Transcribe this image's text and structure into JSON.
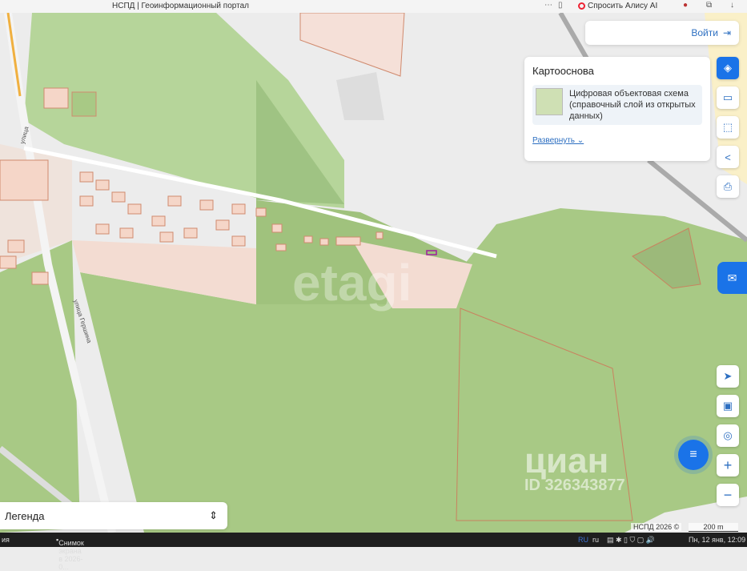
{
  "browser": {
    "tab_title": "НСПД | Геоинформационный портал",
    "alice_button": "Спросить Алису AI"
  },
  "header": {
    "login_label": "Войти",
    "login_icon": "login-arrow-icon"
  },
  "basemap_panel": {
    "title": "Картооснова",
    "layer_name": "Цифровая объектовая схема (справочный слой из открытых данных)",
    "expand_link": "Развернуть"
  },
  "tools": [
    {
      "icon": "layers-edit-icon"
    },
    {
      "icon": "ruler-icon"
    },
    {
      "icon": "area-select-icon"
    },
    {
      "icon": "share-icon"
    },
    {
      "icon": "print-icon"
    }
  ],
  "map_controls": [
    {
      "icon": "locate-icon"
    },
    {
      "icon": "minimap-icon"
    },
    {
      "icon": "geo-search-icon"
    },
    {
      "label": "+"
    },
    {
      "label": "−"
    }
  ],
  "map": {
    "streets": [
      "улица",
      "улица Гершина"
    ],
    "attribution": "НСПД 2026 ©",
    "scale": "200 m",
    "watermark_cian": "циан",
    "watermark_id": "ID 326343877",
    "watermark_etagi": "etagi"
  },
  "legend": {
    "label": "Легенда"
  },
  "taskbar": {
    "left_text": "ия",
    "window": "Снимок экрана в 2026-0...",
    "lang": "RU",
    "kbd": "ru",
    "clock": "Пн, 12 янв, 12:09"
  }
}
